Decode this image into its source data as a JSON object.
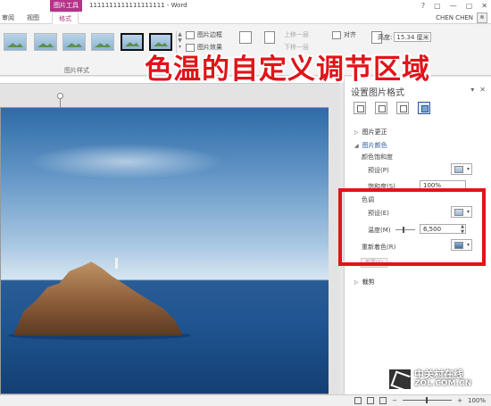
{
  "titlebar": {
    "contextual_tab": "图片工具",
    "doc_title": "1111111111111111111 - Word",
    "controls": [
      "?",
      "▢",
      "—",
      "▢",
      "✕"
    ]
  },
  "tabs": {
    "review": "审阅",
    "view": "视图",
    "format": "格式"
  },
  "user": {
    "name": "CHEN CHEN"
  },
  "ribbon": {
    "group_label": "图片样式",
    "border_label": "图片边框",
    "effects_label": "图片效果",
    "bring_forward": "上移一层",
    "send_backward": "下移一层",
    "align": "对齐",
    "height_label": "高度:",
    "height_value": "15.34 厘米"
  },
  "annotation": "色温的自定义调节区域",
  "pane": {
    "title": "设置图片格式",
    "sections": {
      "corrections": "图片更正",
      "color": "图片颜色",
      "saturation": "颜色饱和度",
      "sat_preset": "预设(P)",
      "sat_value_label": "饱和度(S)",
      "sat_value": "100%",
      "tone": "色调",
      "tone_preset": "预设(E)",
      "temperature_label": "温度(M)",
      "temperature_value": "6,500",
      "recolor": "重新着色(R)",
      "reset": "重置(S)",
      "crop": "裁剪"
    }
  },
  "status": {
    "zoom": "100%"
  },
  "watermark": {
    "cn": "中关村在线",
    "en": "ZOL.COM.CN"
  },
  "colors": {
    "accent": "#b2358a",
    "highlight": "#e0141a",
    "pane_accent": "#2b579a"
  }
}
